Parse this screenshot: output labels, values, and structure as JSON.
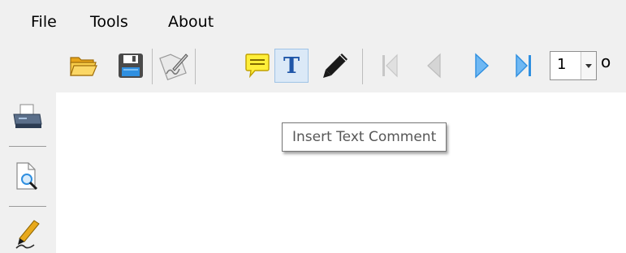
{
  "menu": {
    "file": "File",
    "tools": "Tools",
    "about": "About"
  },
  "toolbar": {
    "text_comment_glyph": "T",
    "page_number": "1",
    "page_of": "o",
    "active_tool": "insert-text-comment"
  },
  "tooltip": {
    "text": "Insert Text Comment"
  },
  "icons": {
    "open": "folder-open-icon",
    "save": "save-icon",
    "sign": "signature-icon",
    "comment": "speech-bubble-icon",
    "text": "text-icon",
    "pencil": "pencil-icon",
    "first": "first-page-icon",
    "prev": "previous-page-icon",
    "next": "next-page-icon",
    "last": "last-page-icon",
    "print": "printer-icon",
    "preview": "print-preview-icon",
    "sign_side": "pen-sign-icon"
  },
  "colors": {
    "chrome": "#f0f0f0",
    "accent_blue": "#2f8fe0",
    "active_bg": "#dbe9f7",
    "comment_yellow": "#ffef3a",
    "disabled_gray": "#c7c7c7"
  }
}
